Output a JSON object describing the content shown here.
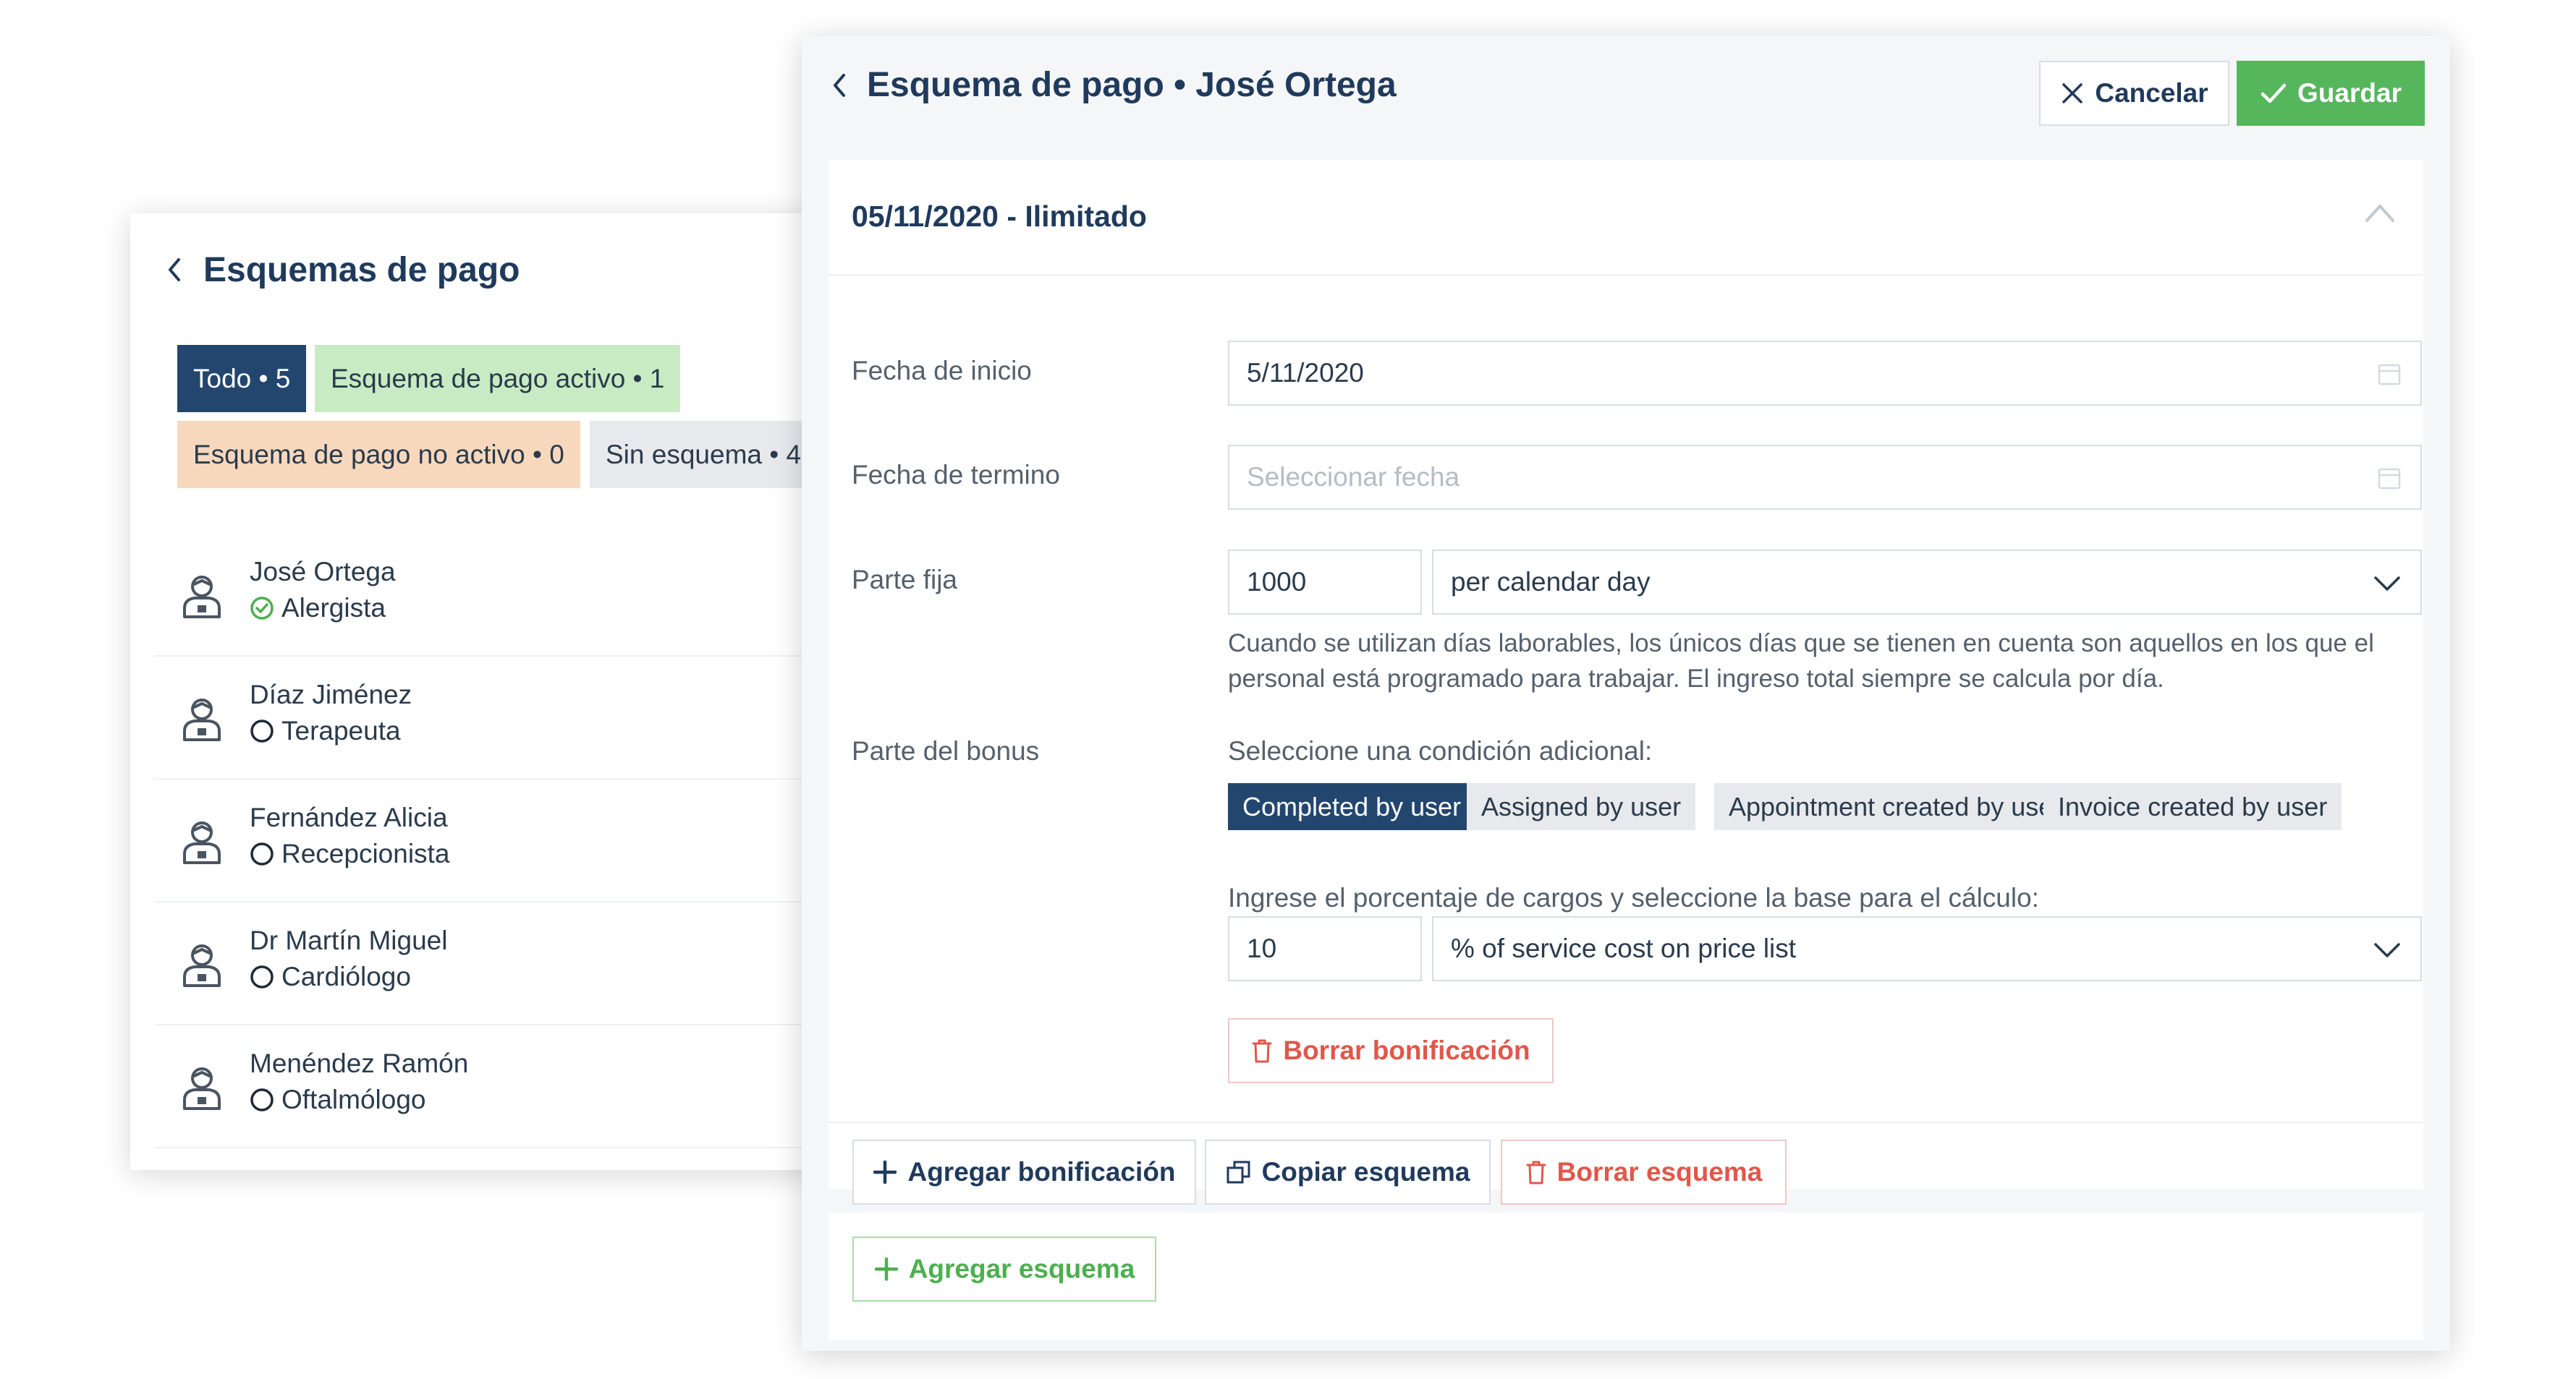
{
  "list_panel": {
    "title": "Esquemas de pago",
    "filters": [
      {
        "label": "Todo • 5"
      },
      {
        "label": "Esquema de pago activo • 1"
      },
      {
        "label": "Esquema de pago no activo • 0"
      },
      {
        "label": "Sin esquema • 4"
      }
    ],
    "staff": [
      {
        "name": "José Ortega",
        "role": "Alergista",
        "has_scheme": true
      },
      {
        "name": "Díaz Jiménez",
        "role": "Terapeuta",
        "has_scheme": false
      },
      {
        "name": "Fernández Alicia",
        "role": "Recepcionista",
        "has_scheme": false
      },
      {
        "name": "Dr Martín Miguel",
        "role": "Cardiólogo",
        "has_scheme": false
      },
      {
        "name": "Menéndez Ramón",
        "role": "Oftalmólogo",
        "has_scheme": false
      }
    ]
  },
  "editor": {
    "title": "Esquema de pago • José Ortega",
    "cancel_label": "Cancelar",
    "save_label": "Guardar",
    "scheme": {
      "title": "05/11/2020 - Ilimitado",
      "start_label": "Fecha de inicio",
      "start_value": "5/11/2020",
      "end_label": "Fecha de termino",
      "end_placeholder": "Seleccionar fecha",
      "fixed_label": "Parte fija",
      "fixed_amount": "1000",
      "fixed_period": "per calendar day",
      "fixed_help": "Cuando se utilizan días laborables, los únicos días que se tienen en cuenta son aquellos en los que el personal está programado para trabajar. El ingreso total siempre se calcula por día.",
      "bonus_label": "Parte del bonus",
      "condition_label": "Seleccione una condición adicional:",
      "conditions": [
        {
          "label": "Completed by user",
          "selected": true
        },
        {
          "label": "Assigned by user",
          "selected": false
        },
        {
          "label": "Appointment created by user",
          "selected": false
        },
        {
          "label": "Invoice created by user",
          "selected": false
        }
      ],
      "percent_label": "Ingrese el porcentaje de cargos y seleccione la base para el cálculo:",
      "percent_value": "10",
      "percent_base": "% of service cost on price list",
      "delete_bonus_label": "Borrar bonificación",
      "add_bonus_label": "Agregar bonificación",
      "copy_label": "Copiar esquema",
      "delete_scheme_label": "Borrar esquema"
    },
    "add_scheme_label": "Agregar esquema"
  },
  "colors": {
    "navy": "#23466e",
    "green": "#56b65b",
    "red": "#e0574b",
    "active_chip": "#c9ebc3",
    "inactive_chip": "#f8d8bd",
    "neutral_chip": "#e7e9ec"
  }
}
